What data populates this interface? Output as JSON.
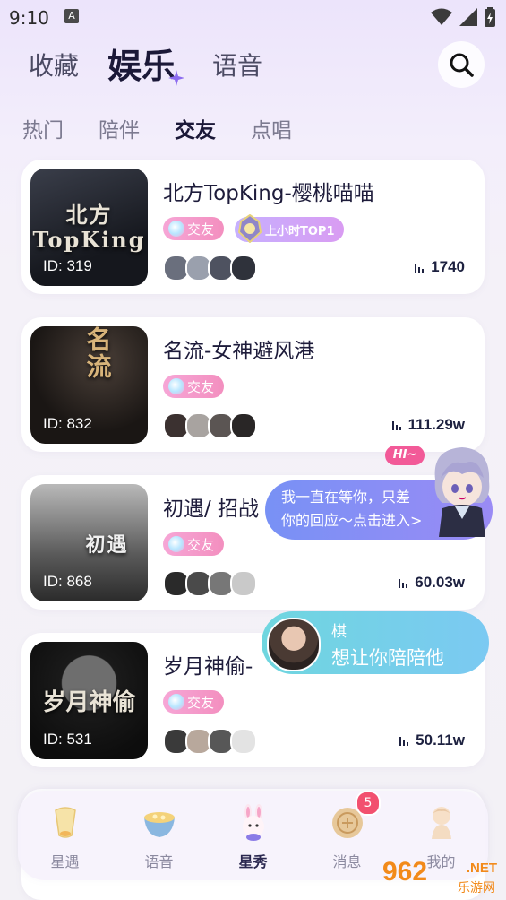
{
  "status_bar": {
    "time": "9:10",
    "app_icon": "A"
  },
  "top_tabs": [
    "收藏",
    "娱乐",
    "语音"
  ],
  "sub_tabs": [
    "热门",
    "陪伴",
    "交友",
    "点唱"
  ],
  "rooms": [
    {
      "title": "北方TopKing-樱桃喵喵",
      "id": "ID: 319",
      "tag": "交友",
      "rank_badge": "上小时TOP1",
      "popularity": "1740",
      "cover_text": "北方\nTopKing"
    },
    {
      "title": "名流-女神避风港",
      "id": "ID: 832",
      "tag": "交友",
      "popularity": "111.29w",
      "cover_text": "名流"
    },
    {
      "title": "初遇/ 招战",
      "id": "ID: 868",
      "tag": "交友",
      "popularity": "60.03w",
      "cover_text": "初遇"
    },
    {
      "title": "岁月神偷-",
      "id": "ID: 531",
      "tag": "交友",
      "popularity": "50.11w",
      "cover_text": "岁月神偷"
    }
  ],
  "bubble_invite": {
    "hi": "HI~",
    "line1": "我一直在等你，只差",
    "line2": "你的回应～点击进入>"
  },
  "bubble_companion": {
    "name": "棋",
    "message": "想让你陪陪他"
  },
  "bottom_nav": [
    {
      "label": "星遇",
      "icon": "lantern-icon"
    },
    {
      "label": "语音",
      "icon": "tea-bowl-icon"
    },
    {
      "label": "星秀",
      "icon": "bunny-icon"
    },
    {
      "label": "消息",
      "icon": "mooncake-icon",
      "badge": "5"
    },
    {
      "label": "我的",
      "icon": "doll-icon"
    }
  ],
  "watermark": {
    "big": "962",
    "net": ".NET",
    "cn": "乐游网"
  },
  "colors": {
    "tag_pink": "#f38fbf",
    "accent_purple": "#9a8bf5",
    "badge_red": "#f2506f"
  }
}
